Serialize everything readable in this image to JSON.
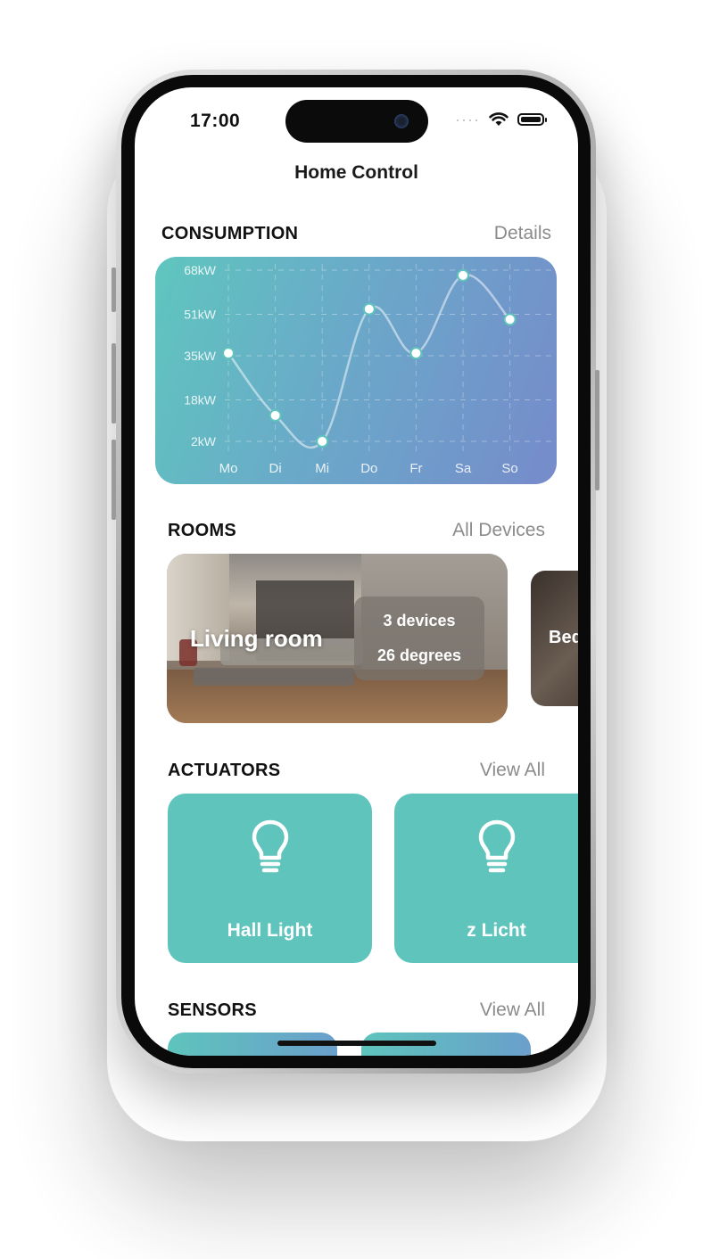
{
  "status_bar": {
    "time": "17:00"
  },
  "nav": {
    "title": "Home Control"
  },
  "consumption": {
    "title": "CONSUMPTION",
    "link": "Details"
  },
  "chart_data": {
    "type": "line",
    "categories": [
      "Mo",
      "Di",
      "Mi",
      "Do",
      "Fr",
      "Sa",
      "So"
    ],
    "values": [
      36,
      12,
      2,
      53,
      36,
      66,
      49
    ],
    "yticks": [
      "68kW",
      "51kW",
      "35kW",
      "18kW",
      "2kW"
    ],
    "ytick_values": [
      68,
      51,
      35,
      18,
      2
    ],
    "ylim": [
      2,
      68
    ],
    "grid": true,
    "colors": {
      "line": "#ffffff",
      "point": "#ffffff",
      "background_start": "#5fc6be",
      "background_end": "#768bcb"
    }
  },
  "rooms": {
    "title": "ROOMS",
    "link": "All Devices",
    "items": [
      {
        "name": "Living room",
        "devices": "3 devices",
        "temperature": "26 degrees"
      },
      {
        "name": "Bed"
      }
    ]
  },
  "actuators": {
    "title": "ACTUATORS",
    "link": "View All",
    "items": [
      {
        "label": "Hall Light",
        "icon": "lightbulb-icon"
      },
      {
        "label": "z Licht",
        "icon": "lightbulb-icon"
      }
    ],
    "color": "#5ec4bc"
  },
  "sensors": {
    "title": "SENSORS",
    "link": "View All"
  }
}
